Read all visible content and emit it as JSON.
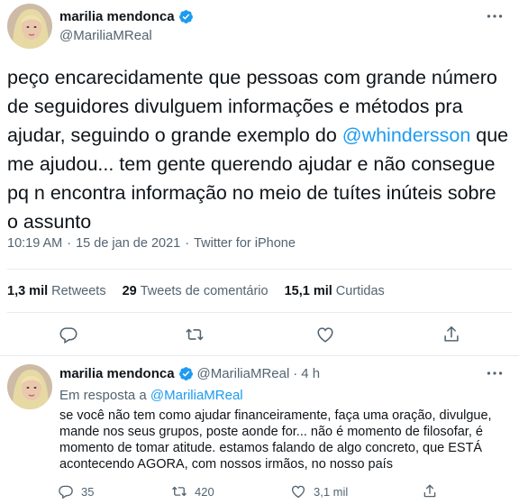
{
  "main_tweet": {
    "display_name": "marilia mendonca",
    "handle": "@MariliaMReal",
    "text_before": "peço encarecidamente que pessoas com grande número de seguidores divulguem informações e métodos pra ajudar, seguindo o grande exemplo do ",
    "mention": "@whindersson",
    "text_after": " que me ajudou... tem gente querendo ajudar e não consegue pq n encontra informação no meio de tuítes inúteis sobre o assunto",
    "time": "10:19 AM",
    "sep1": "·",
    "date": "15 de jan de 2021",
    "sep2": "·",
    "source": "Twitter for iPhone",
    "stats": [
      {
        "num": "1,3 mil",
        "label": "Retweets"
      },
      {
        "num": "29",
        "label": "Tweets de comentário"
      },
      {
        "num": "15,1 mil",
        "label": "Curtidas"
      }
    ]
  },
  "reply_tweet": {
    "display_name": "marilia mendonca",
    "handle": "@MariliaMReal",
    "sep": "·",
    "age": "4 h",
    "reply_to_prefix": "Em resposta a ",
    "reply_to_handle": "@MariliaMReal",
    "text": "se você não tem como ajudar financeiramente, faça uma oração, divulgue, mande nos seus grupos, poste aonde for... não é momento de filosofar, é momento de tomar atitude. estamos falando de algo concreto, que ESTÁ acontecendo AGORA, com nossos irmãos, no nosso país",
    "counts": {
      "replies": "35",
      "retweets": "420",
      "likes": "3,1 mil"
    }
  },
  "icons": {
    "verified": "verified-badge-icon",
    "more": "more-options-icon",
    "reply": "reply-icon",
    "retweet": "retweet-icon",
    "like": "heart-icon",
    "share": "share-icon"
  },
  "colors": {
    "accent": "#1d9bf0",
    "text": "#0f1419",
    "muted": "#536471",
    "divider": "#e6ecf0"
  }
}
